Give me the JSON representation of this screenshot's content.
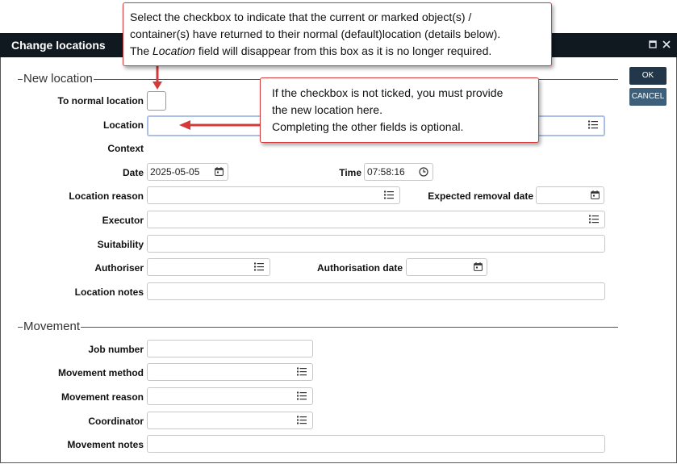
{
  "dialog": {
    "title": "Change locations"
  },
  "buttons": {
    "ok": "OK",
    "cancel": "CANCEL"
  },
  "sections": {
    "new_location": "New location",
    "movement": "Movement"
  },
  "labels": {
    "to_normal_location": "To normal location",
    "location": "Location",
    "context": "Context",
    "date": "Date",
    "time": "Time",
    "location_reason": "Location reason",
    "expected_removal_date": "Expected removal date",
    "executor": "Executor",
    "suitability": "Suitability",
    "authoriser": "Authoriser",
    "authorisation_date": "Authorisation date",
    "location_notes": "Location notes",
    "job_number": "Job number",
    "movement_method": "Movement method",
    "movement_reason": "Movement reason",
    "coordinator": "Coordinator",
    "movement_notes": "Movement notes"
  },
  "values": {
    "date": "2025-05-05",
    "time": "07:58:16",
    "to_normal_location_checked": false
  },
  "callouts": {
    "checkbox": {
      "line1": "Select the checkbox to indicate that the current or marked object(s) /",
      "line2": "container(s) have returned to their normal (default)location (details below).",
      "line3_pre": "The ",
      "line3_em": "Location",
      "line3_post": " field will disappear from this box as it is no longer required."
    },
    "location": {
      "line1": "If the checkbox is not ticked, you must provide",
      "line2": "the new location here.",
      "line3": "Completing the other fields is optional."
    }
  },
  "colors": {
    "titlebar": "#101820",
    "button": "#2b4457",
    "callout_border": "#d43a3a",
    "focus_border": "#a9bfe6"
  }
}
